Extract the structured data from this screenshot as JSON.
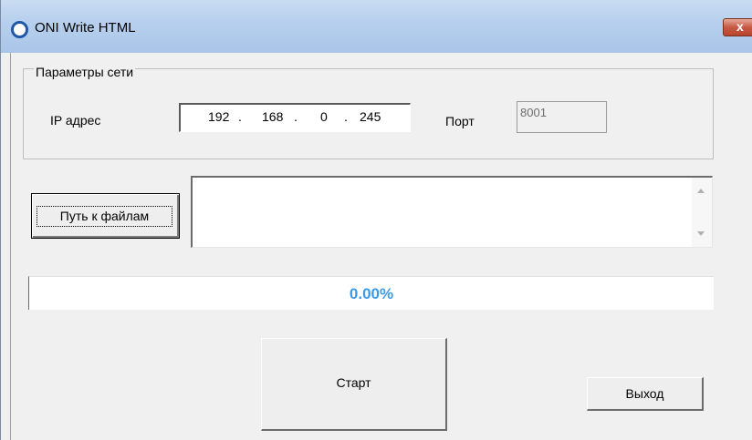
{
  "window": {
    "title": "ONI Write HTML",
    "close_label": "x"
  },
  "network": {
    "group_label": "Параметры сети",
    "ip_label": "IP адрес",
    "ip_octets": [
      "192",
      "168",
      "0",
      "245"
    ],
    "ip_separator": ".",
    "port_label": "Порт",
    "port_value": "8001"
  },
  "files": {
    "button_label": "Путь к файлам",
    "path_value": ""
  },
  "progress": {
    "text": "0.00%",
    "fraction": 0
  },
  "actions": {
    "start_label": "Старт",
    "exit_label": "Выход"
  },
  "colors": {
    "progress_text": "#3a9ae8",
    "title_bar": "#b8d0ee",
    "close_button": "#c75a44"
  }
}
